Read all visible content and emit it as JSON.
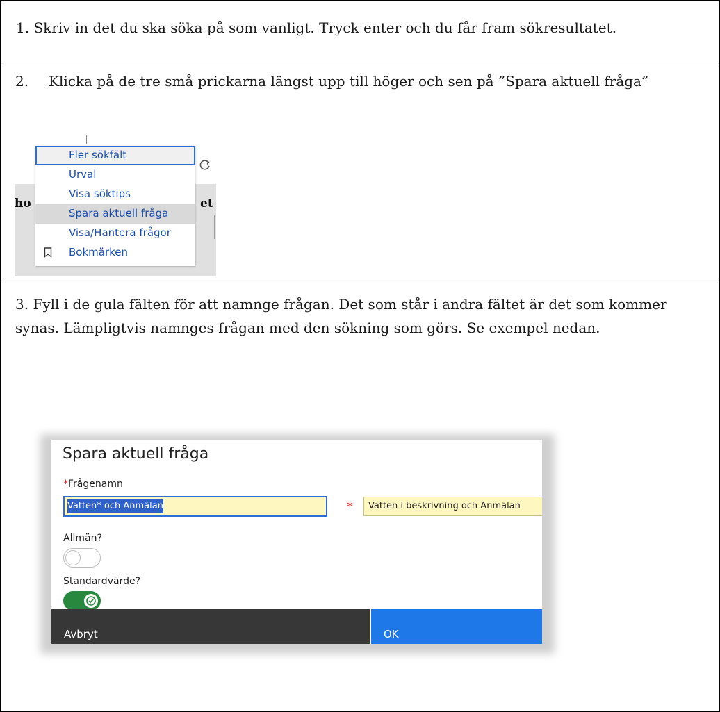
{
  "steps": {
    "step1": "1. Skriv in det du ska söka på som vanligt. Tryck enter och du får fram sökresultatet.",
    "step2_number": "2.",
    "step2": "Klicka på de tre små prickarna längst upp till höger och sen på ”Spara aktuell fråga”",
    "step3": "3. Fyll i de gula fälten för att namnge frågan. Det som står i andra fältet är det som kommer synas. Lämpligtvis namnges frågan med den sökning som görs. Se exempel nedan."
  },
  "menu_screenshot": {
    "items": [
      "Fler sökfält",
      "Urval",
      "Visa söktips",
      "Spara aktuell fråga",
      "Visa/Hantera frågor",
      "Bokmärken"
    ],
    "focused_item": "Fler sökfält",
    "hovered_item": "Spara aktuell fråga",
    "partial_left": "ho",
    "partial_right": "et",
    "link_color": "#1a4fa8"
  },
  "dialog": {
    "title": "Spara aktuell fråga",
    "required_mark": "*",
    "name_label": "Frågenamn",
    "name_value": "Vatten* och Anmälan",
    "display_value": "Vatten i beskrivning och Anmälan",
    "public_label": "Allmän?",
    "public_on": false,
    "default_label": "Standardvärde?",
    "default_on": true,
    "cancel_label": "Avbryt",
    "ok_label": "OK",
    "field_color": "#fff7c0",
    "ok_color": "#1e78e8",
    "toggle_on_color": "#28893e"
  }
}
